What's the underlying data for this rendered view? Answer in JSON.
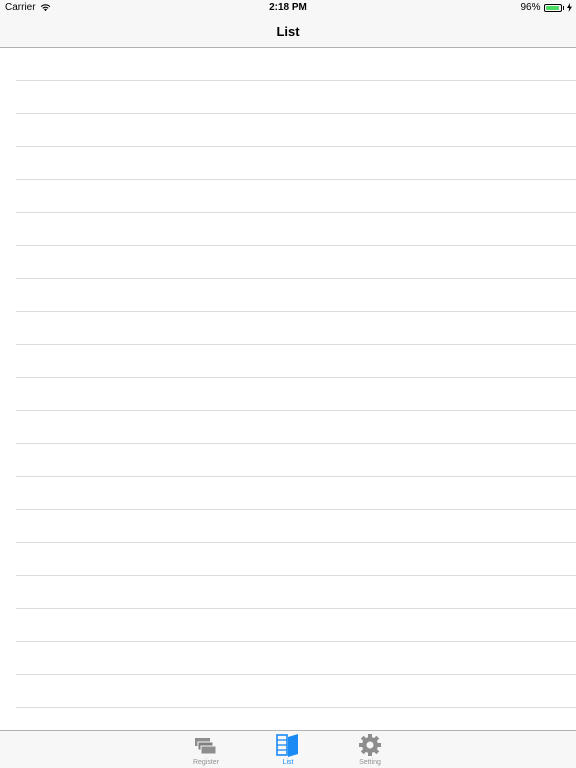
{
  "status_bar": {
    "carrier": "Carrier",
    "time": "2:18 PM",
    "battery_percent": "96%",
    "battery_level": 0.96,
    "wifi_icon": "wifi-icon",
    "battery_icon": "battery-icon",
    "charging_icon": "bolt-icon"
  },
  "nav": {
    "title": "List"
  },
  "table": {
    "rows": [
      "",
      "",
      "",
      "",
      "",
      "",
      "",
      "",
      "",
      "",
      "",
      "",
      "",
      "",
      "",
      "",
      "",
      "",
      "",
      "",
      ""
    ]
  },
  "tab_bar": {
    "tabs": [
      {
        "label": "Register",
        "icon": "register-icon",
        "active": false
      },
      {
        "label": "List",
        "icon": "list-icon",
        "active": true
      },
      {
        "label": "Setting",
        "icon": "gear-icon",
        "active": false
      }
    ]
  },
  "colors": {
    "accent": "#1a8bf5",
    "inactive": "#929292",
    "bar_background": "#f7f7f7",
    "separator": "#dcdcdc",
    "battery_fill": "#4cd964"
  }
}
